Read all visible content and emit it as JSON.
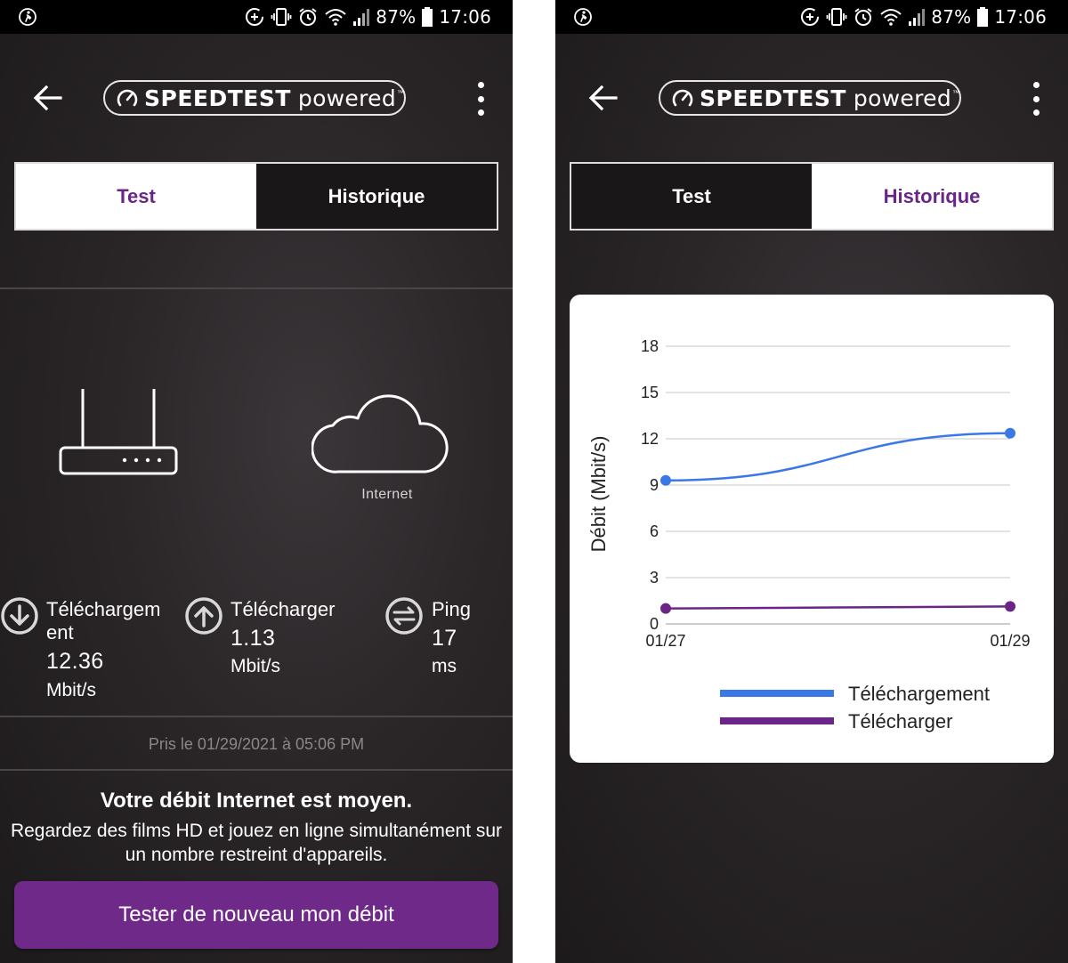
{
  "status_bar": {
    "battery": "87%",
    "time": "17:06"
  },
  "brand": {
    "logo_strong": "SPEEDTEST",
    "logo_light": "powered",
    "trademark": "™"
  },
  "tabs": {
    "test": "Test",
    "history": "Historique"
  },
  "test_screen": {
    "internet_label": "Internet",
    "download": {
      "label_line1": "Téléchargem",
      "label_line2": "ent",
      "value": "12.36",
      "unit": "Mbit/s"
    },
    "upload": {
      "label": "Télécharger",
      "value": "1.13",
      "unit": "Mbit/s"
    },
    "ping": {
      "label": "Ping",
      "value": "17",
      "unit": "ms"
    },
    "taken_at": "Pris le 01/29/2021 à 05:06 PM",
    "verdict_title": "Votre débit Internet est moyen.",
    "verdict_text": "Regardez des films HD et jouez en ligne simultanément sur un nombre restreint d'appareils.",
    "retest_button": "Tester de nouveau mon débit"
  },
  "colors": {
    "accent_purple": "#6a2687",
    "button_purple": "#6f2a89",
    "download_series": "#3b78e7",
    "upload_series": "#6a2687"
  },
  "icons": {
    "back": "arrow-left-icon",
    "menu": "more-vertical-icon",
    "download": "arrow-down-circle-icon",
    "upload": "arrow-up-circle-icon",
    "ping": "swap-arrows-circle-icon",
    "router": "router-icon",
    "cloud": "cloud-icon"
  },
  "chart_data": {
    "type": "line",
    "x": [
      "01/27",
      "01/29"
    ],
    "ylabel": "Débit (Mbit/s)",
    "ylim": [
      0,
      18
    ],
    "yticks": [
      0,
      3,
      6,
      9,
      12,
      15,
      18
    ],
    "grid": true,
    "legend": "bottom",
    "series": [
      {
        "name": "Téléchargement",
        "values": [
          9.3,
          12.36
        ],
        "color": "#3b78e7"
      },
      {
        "name": "Télécharger",
        "values": [
          1.0,
          1.13
        ],
        "color": "#6a2687"
      }
    ]
  }
}
